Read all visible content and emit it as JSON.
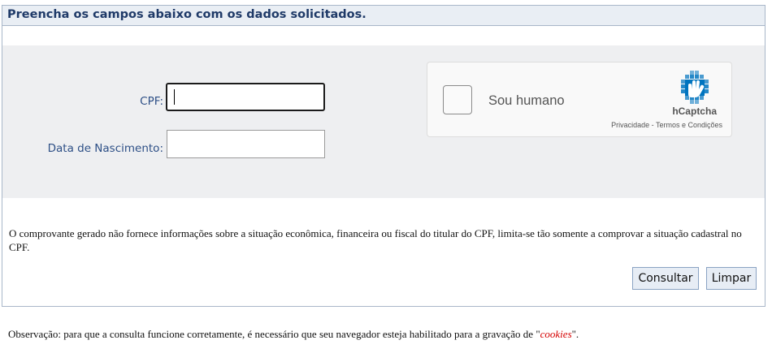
{
  "panel": {
    "header_title": "Preencha os campos abaixo com os dados solicitados."
  },
  "form": {
    "cpf_label": "CPF:",
    "cpf_value": "",
    "birthdate_label": "Data de Nascimento:",
    "birthdate_value": ""
  },
  "captcha": {
    "checkbox_label": "Sou humano",
    "brand": "hCaptcha",
    "links": "Privacidade - Termos e Condições",
    "icon": "hcaptcha-logo-icon",
    "colors": {
      "logo_primary": "#0074BF",
      "logo_light": "#0082BF"
    }
  },
  "notice": {
    "text": "O comprovante gerado não fornece informações sobre a situação econômica, financeira ou fiscal do titular do CPF, limita-se tão somente a comprovar a situação cadastral no CPF."
  },
  "buttons": {
    "consultar": "Consultar",
    "limpar": "Limpar"
  },
  "footer": {
    "prefix": "Observação: para que a consulta funcione corretamente, é necessário que seu navegador esteja habilitado para a gravação de \"",
    "cookies": "cookies",
    "suffix": "\"."
  }
}
